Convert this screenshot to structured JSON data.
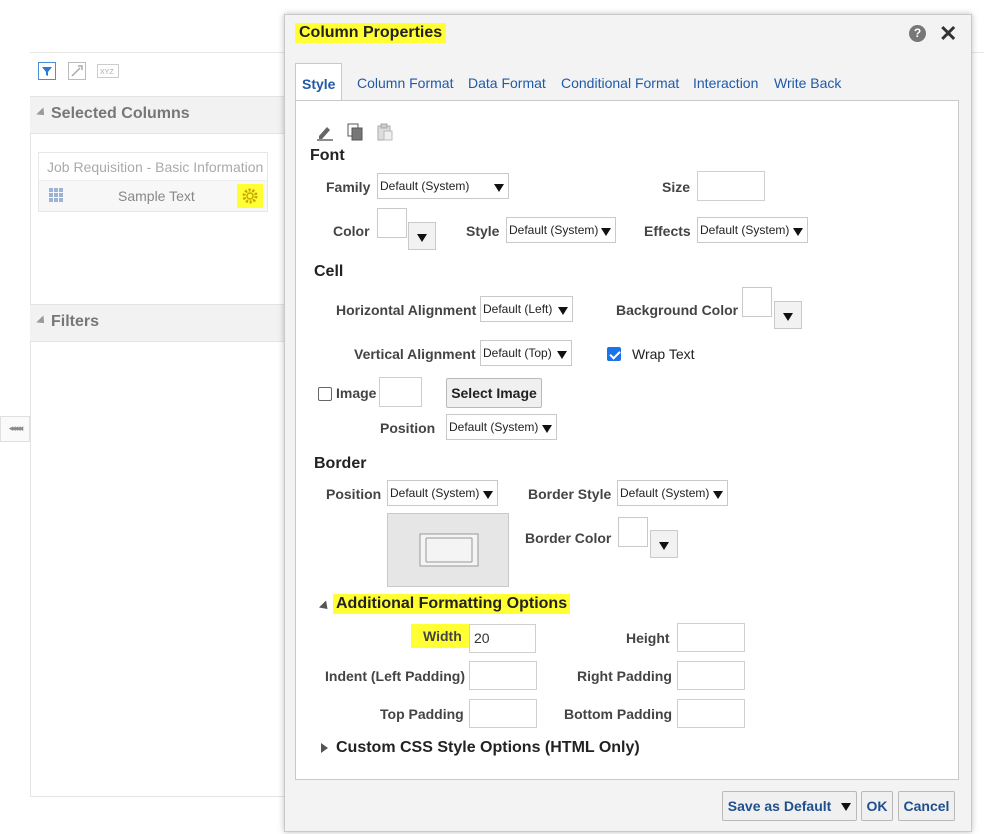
{
  "background": {
    "selected_columns_title": "Selected Columns",
    "subject_area": "Job Requisition - Basic Information",
    "column_name": "Sample Text",
    "filters_title": "Filters",
    "splitter_glyph": "◂◂◂◂◂"
  },
  "dialog": {
    "title": "Column Properties",
    "help": "?",
    "close": "✕",
    "tabs": [
      "Style",
      "Column Format",
      "Data Format",
      "Conditional Format",
      "Interaction",
      "Write Back"
    ],
    "font": {
      "title": "Font",
      "family_label": "Family",
      "family_value": "Default (System)",
      "size_label": "Size",
      "size_value": "",
      "color_label": "Color",
      "style_label": "Style",
      "style_value": "Default (System)",
      "effects_label": "Effects",
      "effects_value": "Default (System)"
    },
    "cell": {
      "title": "Cell",
      "halign_label": "Horizontal Alignment",
      "halign_value": "Default (Left)",
      "bgcolor_label": "Background Color",
      "valign_label": "Vertical Alignment",
      "valign_value": "Default (Top)",
      "wrap_label": "Wrap Text",
      "wrap_checked": true,
      "image_label": "Image",
      "select_image": "Select Image",
      "position_label": "Position",
      "position_value": "Default (System)"
    },
    "border": {
      "title": "Border",
      "position_label": "Position",
      "position_value": "Default (System)",
      "style_label": "Border Style",
      "style_value": "Default (System)",
      "color_label": "Border Color"
    },
    "additional": {
      "title": "Additional Formatting Options",
      "width_label": "Width",
      "width_value": "20",
      "height_label": "Height",
      "height_value": "",
      "indent_label": "Indent (Left Padding)",
      "right_label": "Right Padding",
      "top_label": "Top Padding",
      "bottom_label": "Bottom Padding"
    },
    "custom_css": {
      "title": "Custom CSS Style Options (HTML Only)"
    },
    "footer": {
      "save_default": "Save as Default",
      "ok": "OK",
      "cancel": "Cancel"
    }
  },
  "colors": {
    "highlight": "#ffff33",
    "link_blue": "#1f5aa8",
    "checkbox_blue": "#1a73e8"
  }
}
